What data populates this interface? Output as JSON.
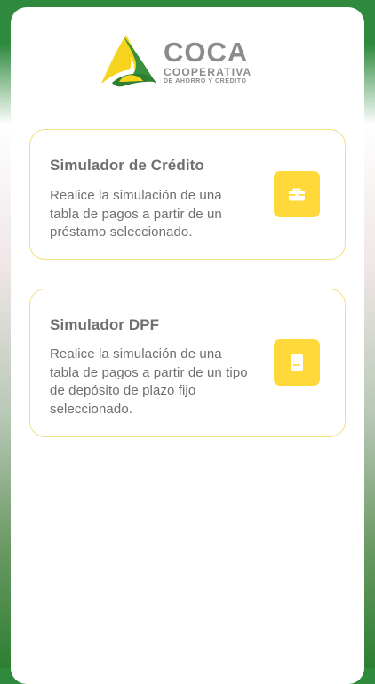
{
  "logo": {
    "brand": "COCA",
    "line1": "COOPERATIVA",
    "line2": "DE AHORRO Y CRÉDITO"
  },
  "cards": [
    {
      "title": "Simulador de Crédito",
      "description": "Realice la simulación de una tabla de pagos a partir de un préstamo seleccionado.",
      "icon": "briefcase-icon"
    },
    {
      "title": "Simulador DPF",
      "description": "Realice la simulación de una tabla de pagos a partir de un tipo de depósito de plazo fijo seleccionado.",
      "icon": "document-icon"
    }
  ],
  "colors": {
    "header_green": "#2f8a3e",
    "card_border": "#f1df86",
    "icon_yellow": "#ffd93a",
    "text_gray": "#6f6f6f"
  }
}
